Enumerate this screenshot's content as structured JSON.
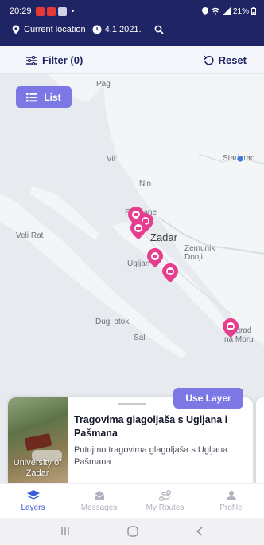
{
  "status_bar": {
    "time": "20:29",
    "battery": "21%"
  },
  "location_bar": {
    "location_label": "Current location",
    "date": "4.1.2021."
  },
  "filter_bar": {
    "filter_label": "Filter (0)",
    "reset_label": "Reset"
  },
  "map": {
    "list_button_label": "List",
    "labels": [
      "Pag",
      "Vir",
      "Nin",
      "Petrčane",
      "Zadar",
      "Veli Rat",
      "Zemunik Donji",
      "Ugljan",
      "Dugi otok",
      "Sali",
      "Starigrad",
      "Biograd na Moru"
    ],
    "accent_color": "#e63d8e"
  },
  "card": {
    "use_layer_label": "Use Layer",
    "image_caption": "University of Zadar",
    "title": "Tragovima glagoljaša s Ugljana i Pašmana",
    "description": "Putujmo tragovima glagoljaša s Ugljana i Pašmana"
  },
  "bottom_nav": {
    "items": [
      {
        "label": "Layers",
        "icon": "layers-icon",
        "active": true
      },
      {
        "label": "Messages",
        "icon": "messages-icon",
        "active": false
      },
      {
        "label": "My Routes",
        "icon": "routes-icon",
        "active": false
      },
      {
        "label": "Profile",
        "icon": "profile-icon",
        "active": false
      }
    ]
  },
  "colors": {
    "header": "#1f2464",
    "primary_button": "#7b78e6",
    "active_nav": "#3d5bd9"
  }
}
